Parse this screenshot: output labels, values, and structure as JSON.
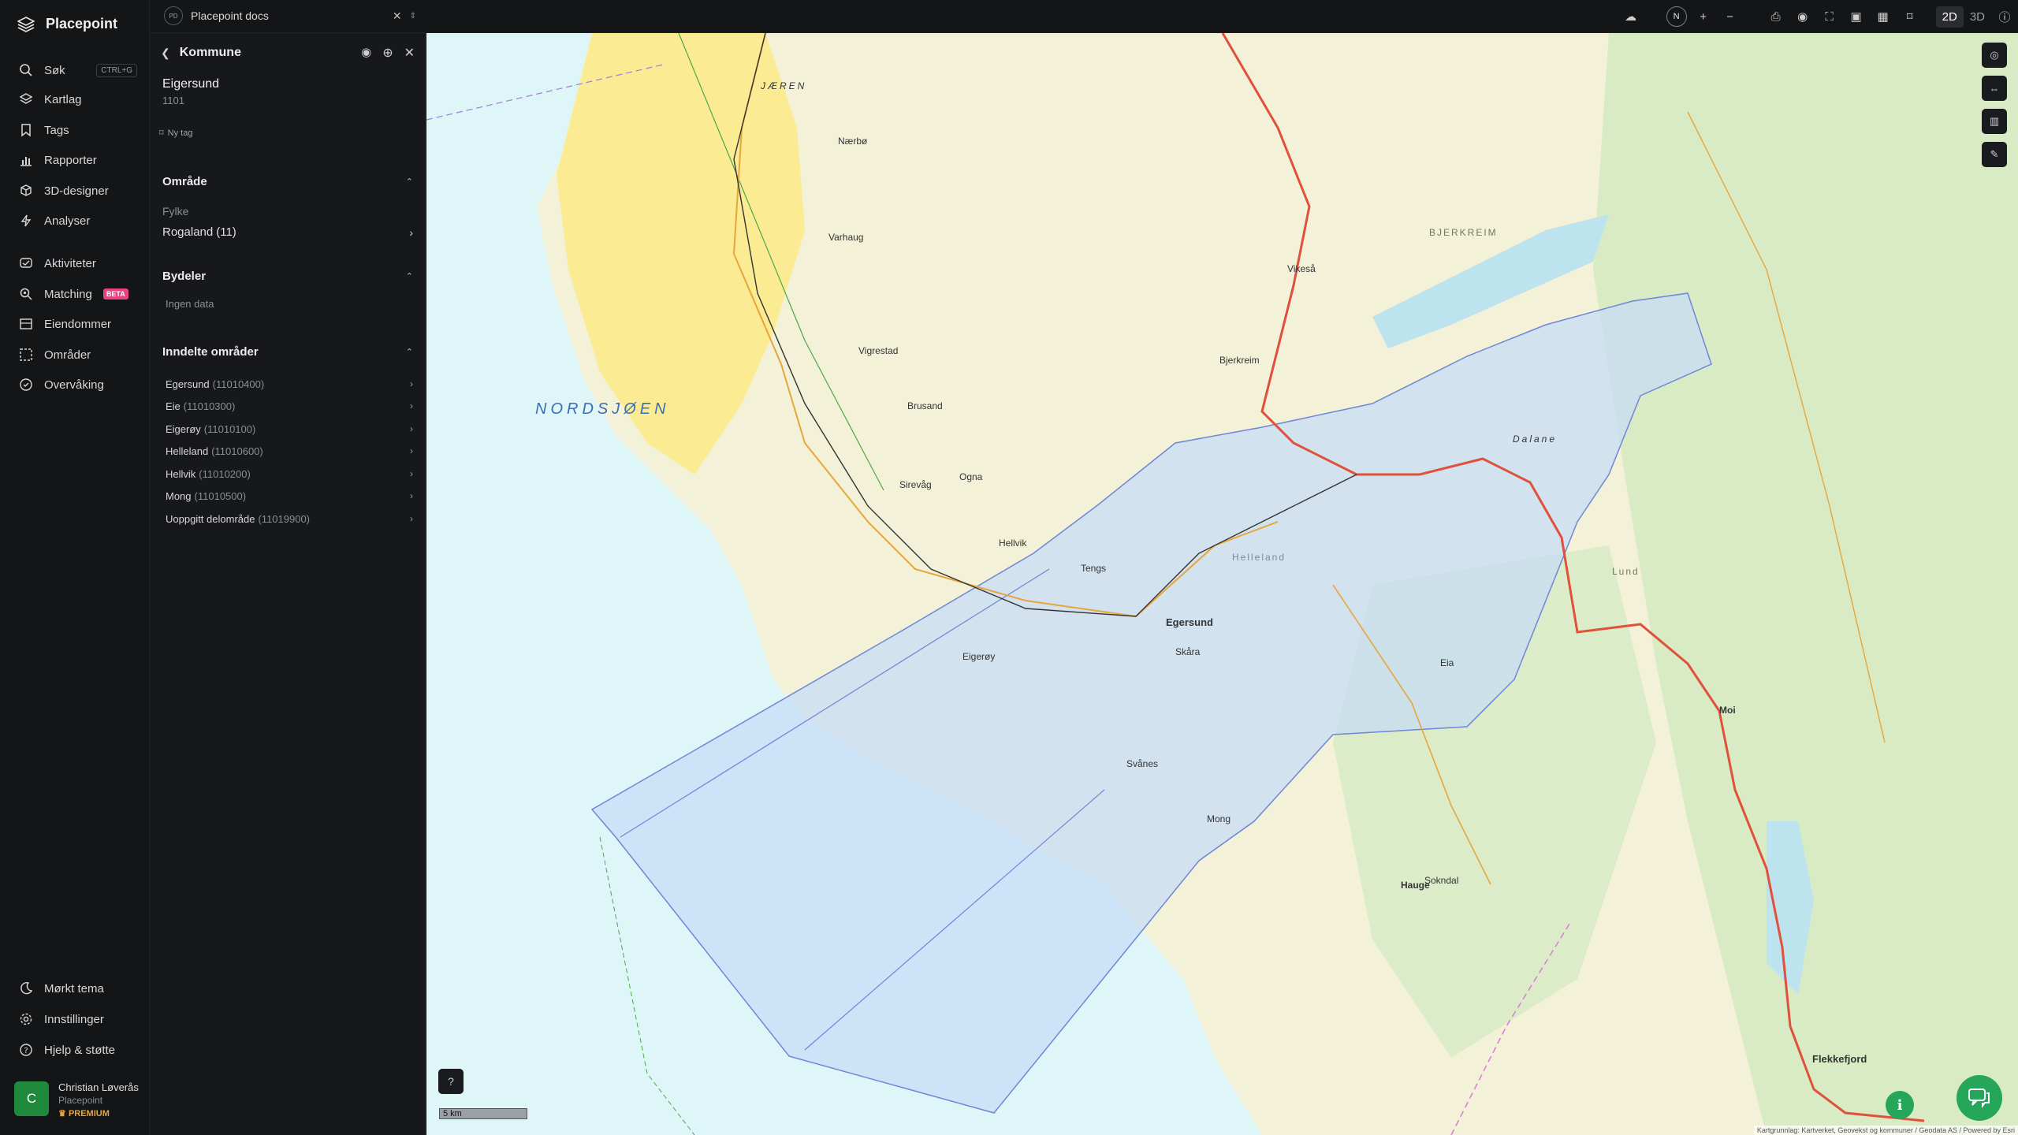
{
  "brand": {
    "name": "Placepoint"
  },
  "nav": {
    "search": {
      "label": "Søk",
      "shortcut": "CTRL+G"
    },
    "items": [
      {
        "label": "Kartlag"
      },
      {
        "label": "Tags"
      },
      {
        "label": "Rapporter"
      },
      {
        "label": "3D-designer"
      },
      {
        "label": "Analyser"
      },
      {
        "label": "Aktiviteter"
      },
      {
        "label": "Matching",
        "badge": "BETA"
      },
      {
        "label": "Eiendommer"
      },
      {
        "label": "Områder"
      },
      {
        "label": "Overvåking"
      }
    ],
    "bottom": [
      {
        "label": "Mørkt tema"
      },
      {
        "label": "Innstillinger"
      },
      {
        "label": "Hjelp & støtte"
      }
    ]
  },
  "user": {
    "initial": "C",
    "name": "Christian Løverås",
    "org": "Placepoint",
    "tier": "PREMIUM"
  },
  "topbar": {
    "doc_badge": "PD",
    "doc_name": "Placepoint docs",
    "compass": "N",
    "zoom_in": "+",
    "zoom_out": "−",
    "mode_2d": "2D",
    "mode_3d": "3D",
    "active_mode": "2D"
  },
  "panel": {
    "title": "Kommune",
    "entity_name": "Eigersund",
    "entity_code": "1101",
    "new_tag": "Ny tag",
    "sections": {
      "omrade": {
        "title": "Område",
        "label": "Fylke",
        "value": "Rogaland",
        "value_code": "(11)"
      },
      "bydeler": {
        "title": "Bydeler",
        "empty": "Ingen data"
      },
      "inndelte": {
        "title": "Inndelte områder",
        "items": [
          {
            "name": "Egersund",
            "code": "(11010400)"
          },
          {
            "name": "Eie",
            "code": "(11010300)"
          },
          {
            "name": "Eigerøy",
            "code": "(11010100)"
          },
          {
            "name": "Helleland",
            "code": "(11010600)"
          },
          {
            "name": "Hellvik",
            "code": "(11010200)"
          },
          {
            "name": "Mong",
            "code": "(11010500)"
          },
          {
            "name": "Uoppgitt delområde",
            "code": "(11019900)"
          }
        ]
      }
    }
  },
  "map": {
    "sea_label": "NORDSJØEN",
    "places": [
      "JÆREN",
      "Nærbø",
      "Varhaug",
      "Vigrestad",
      "Brusand",
      "Sirevåg",
      "Ogna",
      "Hellvik",
      "Egersund",
      "Eigerøy",
      "Helleland",
      "Dalane",
      "Bjerkreim",
      "Vikeså",
      "Lund",
      "Moi",
      "Flekkefjord",
      "Hauge",
      "Sokndal",
      "Tengs",
      "Skåra",
      "Svånes",
      "Mong",
      "Eia",
      "BJERKREIM"
    ],
    "scale": "5 km",
    "attribution": "Kartgrunnlag: Kartverket, Geovekst og kommuner / Geodata AS / Powered by Esri",
    "colors": {
      "sea": "#dff6f9",
      "land": "#f3f1d8",
      "forest": "#d8ebc4",
      "agri": "#fbeb92",
      "selection": "#c7dcf6",
      "selection_stroke": "#6f86d6",
      "road_main": "#e0503a",
      "road_minor": "#e8a53c"
    }
  }
}
